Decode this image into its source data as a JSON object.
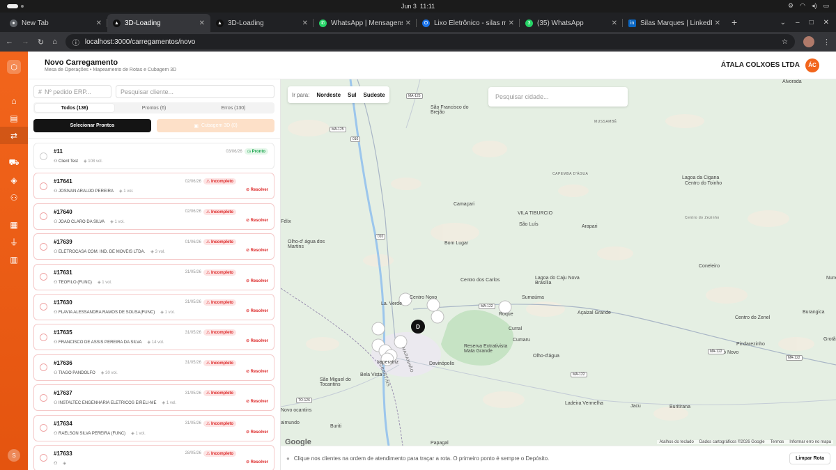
{
  "os": {
    "date": "Jun 3",
    "time": "11:11"
  },
  "tabs": [
    {
      "label": "New Tab",
      "color": "#555"
    },
    {
      "label": "3D-Loading",
      "color": "#222"
    },
    {
      "label": "3D-Loading",
      "color": "#222"
    },
    {
      "label": "WhatsApp | Mensagens",
      "color": "#25d366"
    },
    {
      "label": "Lixo Eletrônico - silas ma",
      "color": "#1a73e8"
    },
    {
      "label": "(35) WhatsApp",
      "color": "#25d366"
    },
    {
      "label": "Silas Marques | LinkedIn",
      "color": "#0a66c2"
    }
  ],
  "address": {
    "url": "localhost:3000/carregamentos/novo"
  },
  "header": {
    "title": "Novo Carregamento",
    "subtitle": "Mesa de Operações • Mapeamento de Rotas e Cubagem 3D",
    "company": "ÁTALA COLXOES LTDA",
    "avatar": "ÁC"
  },
  "sidebar": {
    "user": "S"
  },
  "filters": {
    "order_placeholder": "Nº pedido ERP...",
    "client_placeholder": "Pesquisar cliente...",
    "segments": [
      "Todos (136)",
      "Prontos (6)",
      "Erros (130)"
    ],
    "select_ready": "Selecionar Prontos",
    "cubagem": "Cubagem 3D (0)"
  },
  "orders": [
    {
      "num": "#11",
      "client": "Client Test",
      "vol": "108 vol.",
      "date": "03/06/26",
      "status": "Pronto",
      "ok": true
    },
    {
      "num": "#17641",
      "client": "JOSIVAN ARAUJO PEREIRA",
      "vol": "1 vol.",
      "date": "02/06/26",
      "status": "Incompleto",
      "ok": false
    },
    {
      "num": "#17640",
      "client": "JOAO CLARO DA SILVA",
      "vol": "1 vol.",
      "date": "02/06/26",
      "status": "Incompleto",
      "ok": false
    },
    {
      "num": "#17639",
      "client": "ELETROCASA COM. IND. DE MOVEIS LTDA.",
      "vol": "3 vol.",
      "date": "01/06/26",
      "status": "Incompleto",
      "ok": false
    },
    {
      "num": "#17631",
      "client": "TEOFILO (FUNC)",
      "vol": "1 vol.",
      "date": "31/05/26",
      "status": "Incompleto",
      "ok": false
    },
    {
      "num": "#17630",
      "client": "FLAVIA ALESSANDRA RAMOS DE SOUSA(FUNC)",
      "vol": "1 vol.",
      "date": "31/05/26",
      "status": "Incompleto",
      "ok": false
    },
    {
      "num": "#17635",
      "client": "FRANCISCO DE ASSIS PEREIRA DA SILVA",
      "vol": "14 vol.",
      "date": "31/05/26",
      "status": "Incompleto",
      "ok": false
    },
    {
      "num": "#17636",
      "client": "TIAGO PANDOLFO",
      "vol": "30 vol.",
      "date": "31/05/26",
      "status": "Incompleto",
      "ok": false
    },
    {
      "num": "#17637",
      "client": "INSTALTEC ENGENHARIA ELETRICOS EIRELI-ME",
      "vol": "1 vol.",
      "date": "31/05/26",
      "status": "Incompleto",
      "ok": false
    },
    {
      "num": "#17634",
      "client": "RAELSON SILVA PEREIRA (FUNC)",
      "vol": "1 vol.",
      "date": "31/05/26",
      "status": "Incompleto",
      "ok": false
    },
    {
      "num": "#17633",
      "client": "",
      "vol": "",
      "date": "28/05/26",
      "status": "Incompleto",
      "ok": false
    }
  ],
  "resolve_label": "Resolver",
  "map": {
    "goto_label": "Ir para:",
    "regions": [
      "Nordeste",
      "Sul",
      "Sudeste"
    ],
    "city_placeholder": "Pesquisar cidade...",
    "depot": "D",
    "google": "Google",
    "attribution": [
      "Atalhos do teclado",
      "Dados cartográficos ©2026 Google",
      "Termos",
      "Informar erro no mapa"
    ],
    "hint": "Clique nos clientes na ordem de atendimento para traçar a rota. O primeiro ponto é sempre o Depósito.",
    "clear": "Limpar Rota",
    "places": [
      "Alvorada",
      "São Francisco do Brejão",
      "MUSSAMBÊ",
      "CAPEMBA D'ÁGUA",
      "Lagoa da Cigana",
      "Centro do Toinho",
      "Centro do Zezinho",
      "Camaçari",
      "VILA TIBURCIO",
      "São Luís",
      "Arapari",
      "Félix",
      "Olho-d' água dos Martins",
      "Bom Lugar",
      "Coneleiro",
      "Centro dos Carlos",
      "Lagoa do Caju Nova Brasília",
      "Sumaúma",
      "Açaizal Grande",
      "Burangica",
      "Centro do Zenel",
      "Grotão",
      "Pindarezinho",
      "Centro Novo",
      "Curral",
      "Cumaru",
      "Olho-d'água",
      "Reserva Extrativista Mata Grande",
      "Davinópolis",
      "Bela Vista",
      "Imperatriz",
      "São Miguel do Tocantins",
      "MARANHÃO",
      "TOCANTINS",
      "Ladeira Vermelha",
      "Jacu",
      "Buritirana",
      "Buriti",
      "Novo ocantins",
      "aimundo",
      "Papagal",
      "La. Verde",
      "Centro Novo",
      "Roque",
      "Nunes"
    ],
    "roads": [
      "MA-125",
      "MA-125",
      "010",
      "010",
      "MA-122",
      "MA-122",
      "MA-122",
      "MA-122",
      "TO-126"
    ]
  }
}
